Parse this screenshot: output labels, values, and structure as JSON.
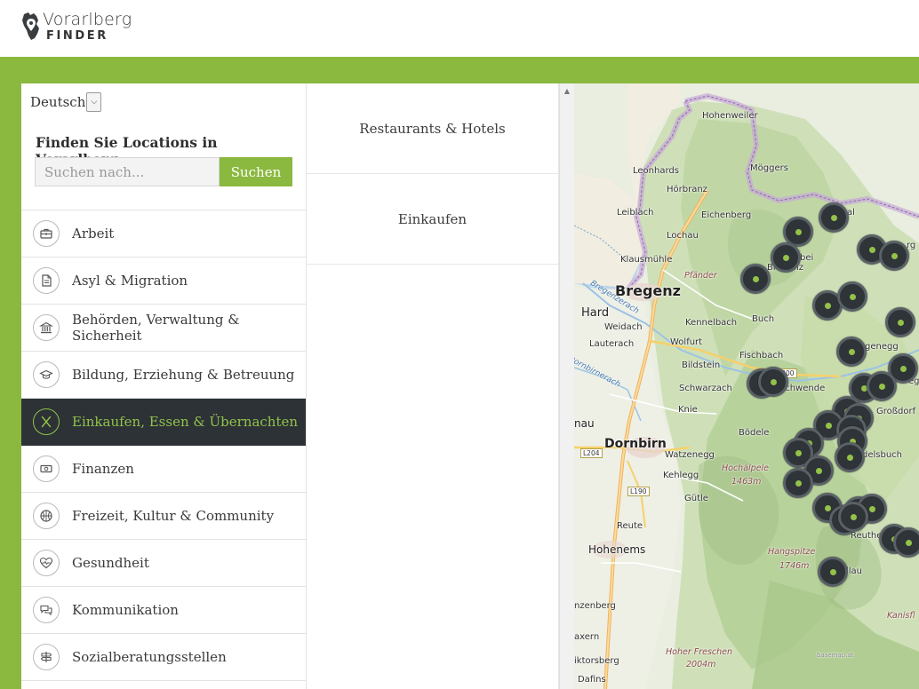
{
  "brand": {
    "title": "Vorarlberg",
    "subtitle": "FINDER",
    "icon": "map-pin-icon"
  },
  "colors": {
    "accent": "#8bb83f",
    "active_bg": "#2c3236",
    "active_text": "#93c24a"
  },
  "language": {
    "selected": "Deutsch",
    "icon": "chevron-down-icon"
  },
  "search": {
    "heading": "Finden Sie Locations in Vorarlberg:",
    "placeholder": "Suchen nach...",
    "button": "Suchen"
  },
  "categories": [
    {
      "label": "Arbeit",
      "icon": "briefcase-icon",
      "active": false
    },
    {
      "label": "Asyl & Migration",
      "icon": "document-icon",
      "active": false
    },
    {
      "label": "Behörden, Verwaltung & Sicherheit",
      "icon": "government-building-icon",
      "active": false
    },
    {
      "label": "Bildung, Erziehung & Betreuung",
      "icon": "graduation-cap-icon",
      "active": false
    },
    {
      "label": "Einkaufen, Essen & Übernachten",
      "icon": "fork-knife-icon",
      "active": true
    },
    {
      "label": "Finanzen",
      "icon": "banknote-icon",
      "active": false
    },
    {
      "label": "Freizeit, Kultur & Community",
      "icon": "ball-icon",
      "active": false
    },
    {
      "label": "Gesundheit",
      "icon": "heart-pulse-icon",
      "active": false
    },
    {
      "label": "Kommunikation",
      "icon": "chat-bubbles-icon",
      "active": false
    },
    {
      "label": "Sozialberatungsstellen",
      "icon": "signpost-icon",
      "active": false
    }
  ],
  "subcategories": [
    "Restaurants & Hotels",
    "Einkaufen"
  ],
  "map": {
    "places": {
      "hohenweiler": "Hohenweiler",
      "leonhards": "Leonhards",
      "moeggers": "Möggers",
      "hoerbranz": "Hörbranz",
      "leiblach": "Leiblach",
      "eichenberg": "Eichenberg",
      "lochau": "Lochau",
      "klausmuehle": "Klausmühle",
      "pfaender": "Pfänder",
      "bregenz": "Bregenz",
      "bregenz_small": "Bregenz",
      "hard": "Hard",
      "kennelbach": "Kennelbach",
      "buch": "Buch",
      "weidach": "Weidach",
      "lauterach": "Lauterach",
      "wolfurt": "Wolfurt",
      "fischbach": "Fischbach",
      "bildstein": "Bildstein",
      "schwarzach": "Schwarzach",
      "knie": "Knie",
      "schwende": "schwende",
      "bodele": "Bödele",
      "dornbirn": "Dornbirn",
      "watzenegg": "Watzenegg",
      "kehlegg": "Kehlegg",
      "hochaelpele": "Hochälpele",
      "hochaelpele_alt": "1463m",
      "guetle": "Gütle",
      "reute": "Reute",
      "hohenems": "Hohenems",
      "hangspitze": "Hangspitze",
      "hangspitze_alt": "1746m",
      "hoher_freschen": "Hoher Freschen",
      "hoher_freschen_alt": "2004m",
      "dafins": "Dafins",
      "viktorsberg": "iktorsberg",
      "nzenberg": "nzenberg",
      "axern": "axern",
      "nau": "nau",
      "grossdorf": "Großdorf",
      "genegg": "genegg",
      "delsbuch": "delsbuch",
      "reuthe": "Reuthe",
      "llau": "llau",
      "lbei": "bei",
      "al": "al",
      "rg": "rg",
      "eg": "eg",
      "kanisfl": "Kanisfl",
      "bregenzerach": "Bregenzerach",
      "dornbirnerach": "Dornbirnerach",
      "basemap": "basemap.at"
    },
    "roads": {
      "l200": "L200",
      "l204": "L204",
      "l190": "L190"
    }
  }
}
